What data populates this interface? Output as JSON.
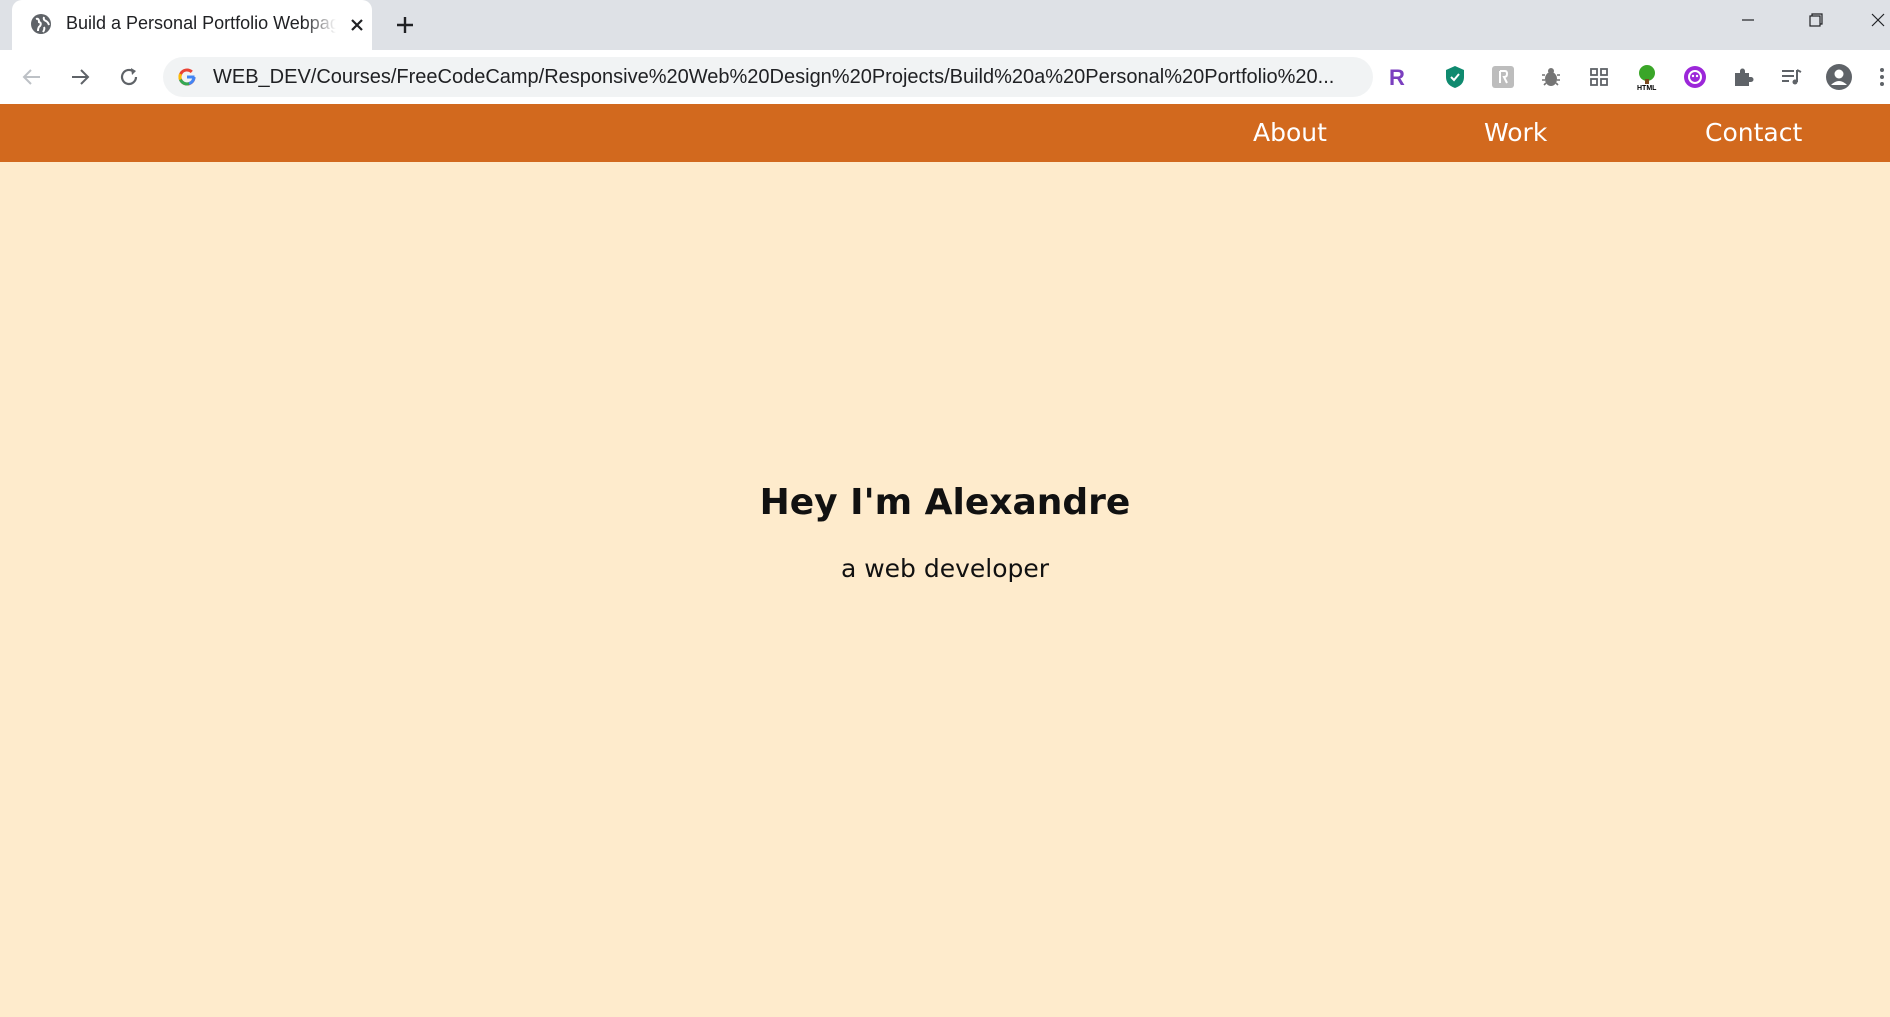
{
  "browser": {
    "tab": {
      "title": "Build a Personal Portfolio Webpage"
    },
    "address_bar": {
      "url": "WEB_DEV/Courses/FreeCodeCamp/Responsive%20Web%20Design%20Projects/Build%20a%20Personal%20Portfolio%20..."
    },
    "extensions": [
      "r-extension-icon",
      "shield-extension-icon",
      "gray-extension-icon",
      "bug-extension-icon",
      "grid-extension-icon",
      "html-tree-extension-icon",
      "purple-circle-extension-icon",
      "puzzle-icon",
      "media-queue-icon",
      "profile-icon"
    ]
  },
  "page": {
    "nav": {
      "about": "About",
      "work": "Work",
      "contact": "Contact"
    },
    "hero": {
      "title": "Hey I'm Alexandre",
      "subtitle": "a web developer"
    }
  },
  "colors": {
    "navbar": "#d2691e",
    "background": "#feebcc",
    "tabstrip": "#dee1e6"
  }
}
